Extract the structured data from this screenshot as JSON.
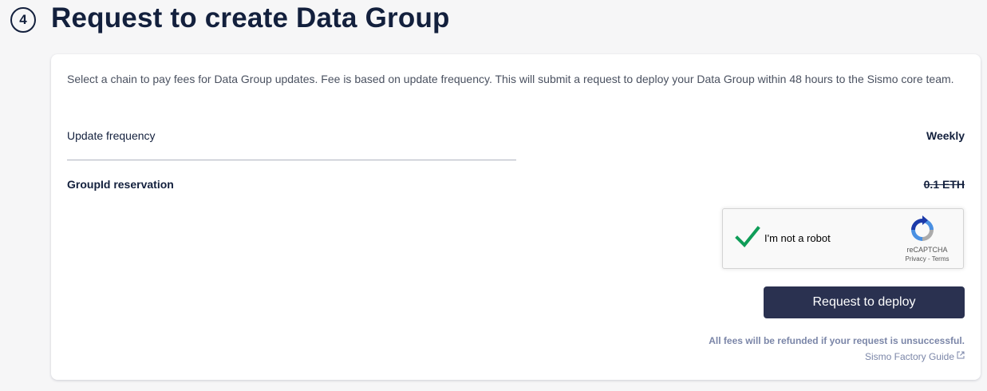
{
  "step": {
    "number": "4",
    "title": "Request to create Data Group"
  },
  "card": {
    "description": "Select a chain to pay fees for Data Group updates. Fee is based on update frequency. This will submit a request to deploy your Data Group within 48 hours to the Sismo core team.",
    "update_frequency": {
      "label": "Update frequency",
      "value": "Weekly"
    },
    "groupid_reservation": {
      "label": "GroupId reservation",
      "value": "0.1 ETH"
    },
    "recaptcha": {
      "label": "I'm not a robot",
      "brand": "reCAPTCHA",
      "links": "Privacy - Terms",
      "checked": true
    },
    "deploy_button": "Request to deploy",
    "refund_note": "All fees will be refunded if your request is unsuccessful.",
    "guide_link": "Sismo Factory Guide"
  },
  "colors": {
    "primary_dark": "#13203d",
    "button_bg": "#2a3150",
    "muted_link": "#7b86a8",
    "check_green": "#0f9d58"
  }
}
